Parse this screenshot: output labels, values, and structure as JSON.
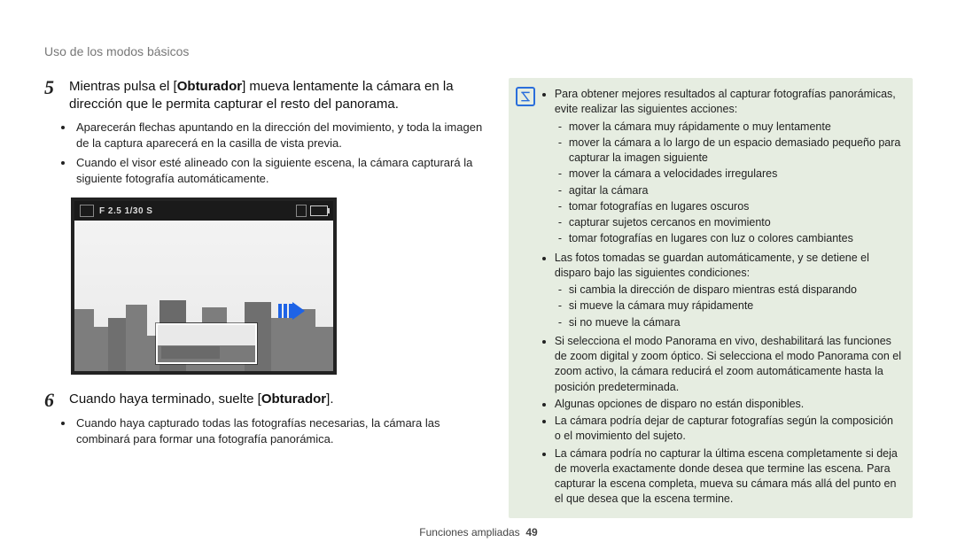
{
  "section_title": "Uso de los modos básicos",
  "steps": [
    {
      "num": "5",
      "text_parts": [
        "Mientras pulsa el [",
        "Obturador",
        "] mueva lentamente la cámara en la dirección que le permita capturar el resto del panorama."
      ],
      "sub": [
        "Aparecerán flechas apuntando en la dirección del movimiento, y toda la imagen de la captura aparecerá en la casilla de vista previa.",
        "Cuando el visor esté alineado con la siguiente escena, la cámara capturará la siguiente fotografía automáticamente."
      ]
    },
    {
      "num": "6",
      "text_parts": [
        "Cuando haya terminado, suelte [",
        "Obturador",
        "]."
      ],
      "sub": [
        "Cuando haya capturado todas las fotografías necesarias, la cámara las combinará para formar una fotografía panorámica."
      ]
    }
  ],
  "camera_hud": {
    "exposure": "F 2.5 1/30 S"
  },
  "tips": {
    "intro": "Para obtener mejores resultados al capturar fotografías panorámicas, evite realizar las siguientes acciones:",
    "intro_items": [
      "mover la cámara muy rápidamente o muy lentamente",
      "mover la cámara a lo largo de un espacio demasiado pequeño para capturar la imagen siguiente",
      "mover la cámara a velocidades irregulares",
      "agitar la cámara",
      "tomar fotografías en lugares oscuros",
      "capturar sujetos cercanos en movimiento",
      "tomar fotografías en lugares con luz o colores cambiantes"
    ],
    "second": "Las fotos tomadas se guardan automáticamente, y se detiene el disparo bajo las siguientes condiciones:",
    "second_items": [
      "si cambia la dirección de disparo mientras está disparando",
      "si mueve la cámara muy rápidamente",
      "si no mueve la cámara"
    ],
    "rest": [
      "Si selecciona el modo Panorama en vivo, deshabilitará las funciones de zoom digital y zoom óptico. Si selecciona el modo Panorama con el zoom activo, la cámara reducirá el zoom automáticamente hasta la posición predeterminada.",
      "Algunas opciones de disparo no están disponibles.",
      "La cámara podría dejar de capturar fotografías según la composición o el movimiento del sujeto.",
      "La cámara podría no capturar la última escena completamente si deja de moverla exactamente donde desea que termine las escena. Para capturar la escena completa, mueva su cámara más allá del punto en el que desea que la escena termine."
    ]
  },
  "footer": {
    "label": "Funciones ampliadas",
    "page": "49"
  }
}
